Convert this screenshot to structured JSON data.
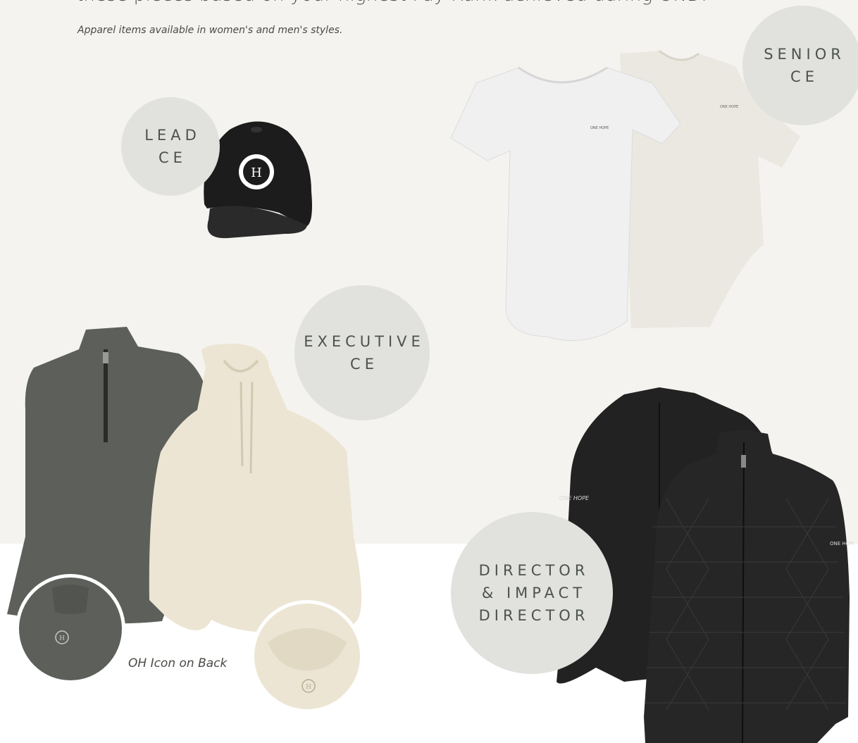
{
  "header": {
    "headline": "these pieces based on your highest Pay Rank achieved during OND.",
    "subnote": "Apparel items available in women's and men's styles."
  },
  "tiers": {
    "lead": "LEAD\nCE",
    "senior": "SENIOR\nCE",
    "executive": "EXECUTIVE\nCE",
    "director": "DIRECTOR\n& IMPACT\nDIRECTOR"
  },
  "products": {
    "hat_logo": "H",
    "tshirt_logo": "ONE HOPE",
    "jacket_sleeve_text": "ONE HOPE",
    "icon_caption": "OH Icon on Back"
  },
  "colors": {
    "background_top": "#f4f3ef",
    "badge": "#e1e2de",
    "text": "#4a4a46"
  }
}
